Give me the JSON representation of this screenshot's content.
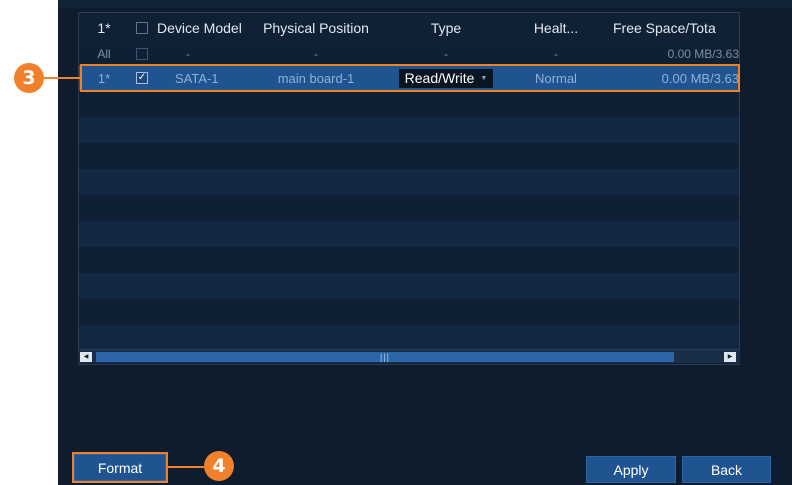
{
  "table": {
    "headers": {
      "no": "1*",
      "model": "Device Model",
      "position": "Physical Position",
      "type": "Type",
      "health": "Healt...",
      "free": "Free Space/Tota"
    },
    "all_row": {
      "no": "All",
      "model": "-",
      "position": "-",
      "type": "-",
      "health": "-",
      "free": "0.00 MB/3.63"
    },
    "rows": [
      {
        "no": "1*",
        "checked": "✓",
        "model": "SATA-1",
        "position": "main board-1",
        "type": "Read/Write",
        "health": "Normal",
        "free": "0.00 MB/3.63"
      }
    ]
  },
  "buttons": {
    "format": "Format",
    "apply": "Apply",
    "back": "Back"
  },
  "callouts": {
    "step3": "3",
    "step4": "4"
  },
  "colors": {
    "accent_orange": "#f0812a",
    "button_blue": "#1f5490",
    "background": "#0e1c2e"
  }
}
